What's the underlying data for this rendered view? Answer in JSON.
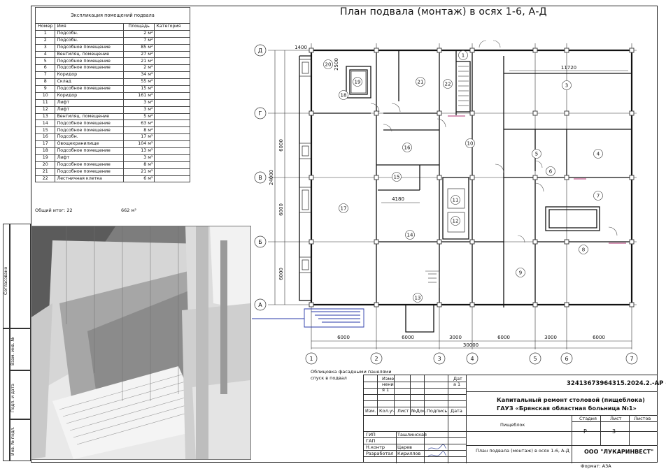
{
  "plan_title": "План подвала (монтаж) в осях 1-6, А-Д",
  "explication": {
    "caption": "Экспликация помещений подвала",
    "headers": [
      "Номер",
      "Имя",
      "Площадь",
      "Категория"
    ],
    "rows": [
      [
        "1",
        "Подсобн.",
        "2 м²",
        ""
      ],
      [
        "2",
        "Подсобн.",
        "7 м²",
        ""
      ],
      [
        "3",
        "Подсобное помещение",
        "85 м²",
        ""
      ],
      [
        "4",
        "Вентиляц. помещение",
        "27 м²",
        ""
      ],
      [
        "5",
        "Подсобное помещение",
        "21 м²",
        ""
      ],
      [
        "6",
        "Подсобное помещение",
        "2 м²",
        ""
      ],
      [
        "7",
        "Коридор",
        "34 м²",
        ""
      ],
      [
        "8",
        "Склад",
        "55 м²",
        ""
      ],
      [
        "9",
        "Подсобное помещение",
        "15 м²",
        ""
      ],
      [
        "10",
        "Коридор",
        "161 м²",
        ""
      ],
      [
        "11",
        "Лифт",
        "3 м²",
        ""
      ],
      [
        "12",
        "Лифт",
        "3 м²",
        ""
      ],
      [
        "13",
        "Вентиляц. помещение",
        "5 м²",
        ""
      ],
      [
        "14",
        "Подсобное помещение",
        "63 м²",
        ""
      ],
      [
        "15",
        "Подсобное помещение",
        "8 м²",
        ""
      ],
      [
        "16",
        "Подсобн.",
        "17 м²",
        ""
      ],
      [
        "17",
        "Овощехранилище",
        "104 м²",
        ""
      ],
      [
        "18",
        "Подсобное помещение",
        "13 м²",
        ""
      ],
      [
        "19",
        "Лифт",
        "3 м²",
        ""
      ],
      [
        "20",
        "Подсобное помещение",
        "8 м²",
        ""
      ],
      [
        "21",
        "Подсобное помещение",
        "21 м²",
        ""
      ],
      [
        "22",
        "Лестничная клетка",
        "6 м²",
        ""
      ]
    ],
    "total_label": "Общий итог: 22",
    "total_area": "662 м²"
  },
  "axes": {
    "columns": [
      "1",
      "2",
      "3",
      "4",
      "5",
      "6",
      "7"
    ],
    "rows": [
      "Д",
      "Г",
      "В",
      "Б",
      "А"
    ]
  },
  "dimensions": {
    "bottom_spans": [
      "6000",
      "6000",
      "3000",
      "6000",
      "3000",
      "6000"
    ],
    "bottom_total": "30000",
    "left_spans": [
      "6000",
      "6000",
      "6000"
    ],
    "left_total": "24000",
    "top_left": "1400",
    "inner_top": "11720",
    "inner_mid": "4180",
    "small": "2500"
  },
  "room_tags": [
    "1",
    "3",
    "4",
    "5",
    "6",
    "7",
    "8",
    "9",
    "10",
    "11",
    "12",
    "13",
    "14",
    "15",
    "16",
    "17",
    "18",
    "19",
    "20",
    "21",
    "22"
  ],
  "annotation": [
    "Облицовка фасадными панелями",
    "спуск в подвал"
  ],
  "side_labels": [
    "Согласовано",
    "Взам. инв. №",
    "Подп. и дата",
    "Инв. № подл."
  ],
  "title_block": {
    "doc_code": "32413673964315.2024.2.-АР -",
    "project_line1": "Капитальный ремонт столовой (пищеблока)",
    "project_line2": "ГАУЗ «Брянская областная больница №1»",
    "building": "Пищеблок",
    "sheet_title": "План подвала (монтаж) в осях 1-6, А-Д",
    "company": "ООО \"ЛУКАРИНВЕСТ\"",
    "rev_head": [
      "Изме",
      "нени",
      "я 1"
    ],
    "rev_date": [
      "Дат",
      "а 1"
    ],
    "col_heads": [
      "Изм.",
      "Кол.уч",
      "Лист",
      "№Док.",
      "Подпись",
      "Дата"
    ],
    "stage_head": "Стадия",
    "sheet_head": "Лист",
    "sheets_head": "Листов",
    "stage": "Р",
    "sheet_no": "3",
    "roles": [
      {
        "role": "ГИП",
        "name": "Ташлинская"
      },
      {
        "role": "ГАП",
        "name": ""
      },
      {
        "role": "Н.контр",
        "name": "Царев"
      },
      {
        "role": "Разработал",
        "name": "Кириллов"
      }
    ],
    "format": "Формат: А3А"
  }
}
